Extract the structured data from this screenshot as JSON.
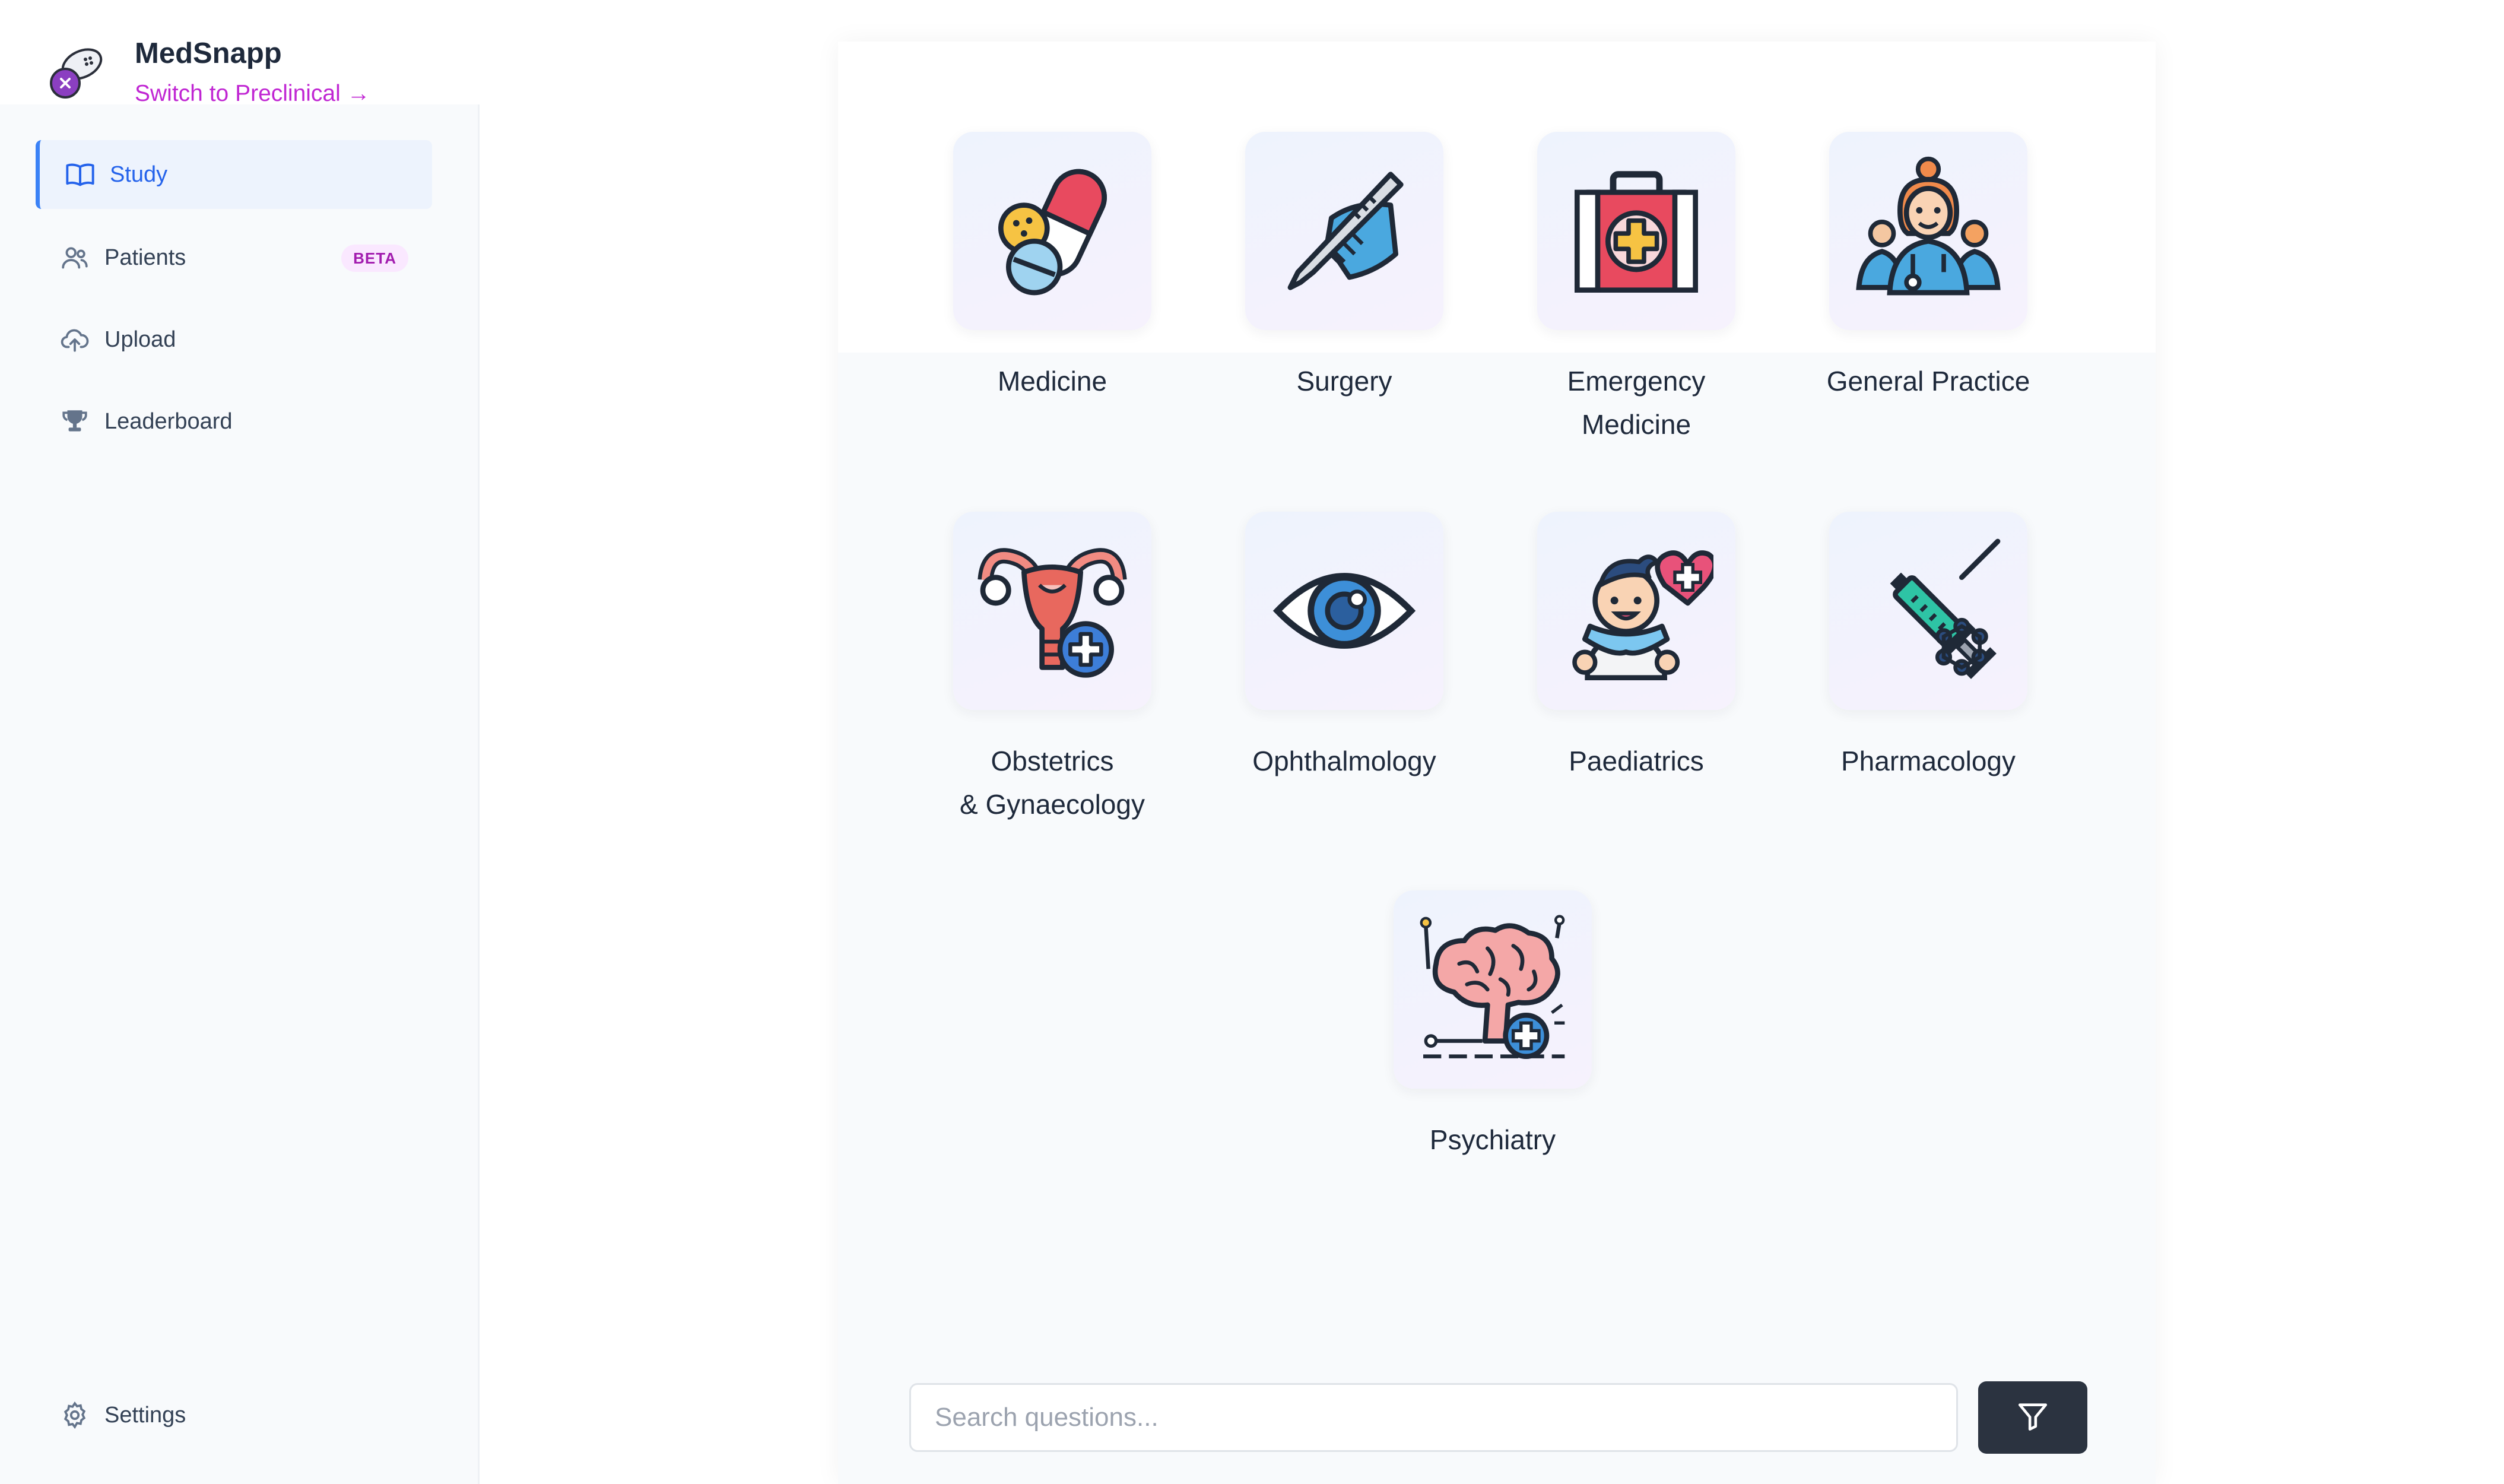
{
  "app": {
    "name": "MedSnapp",
    "switch_link": "Switch to Preclinical →"
  },
  "sidebar": {
    "items": [
      {
        "label": "Study",
        "icon": "book-icon",
        "active": true
      },
      {
        "label": "Patients",
        "icon": "users-icon",
        "badge": "BETA"
      },
      {
        "label": "Upload",
        "icon": "cloud-upload-icon"
      },
      {
        "label": "Leaderboard",
        "icon": "trophy-icon"
      }
    ],
    "settings": {
      "label": "Settings",
      "icon": "gear-icon"
    }
  },
  "specialties": [
    {
      "label": "Medicine",
      "icon": "pill-capsule-icon"
    },
    {
      "label": "Surgery",
      "icon": "scalpel-hand-icon"
    },
    {
      "label": "Emergency\nMedicine",
      "icon": "first-aid-kit-icon"
    },
    {
      "label": "General Practice",
      "icon": "doctor-team-icon"
    },
    {
      "label": "Obstetrics\n& Gynaecology",
      "icon": "uterus-icon"
    },
    {
      "label": "Ophthalmology",
      "icon": "eye-icon"
    },
    {
      "label": "Paediatrics",
      "icon": "baby-heart-icon"
    },
    {
      "label": "Pharmacology",
      "icon": "syringe-molecule-icon"
    },
    {
      "label": "Psychiatry",
      "icon": "brain-icon"
    }
  ],
  "search": {
    "placeholder": "Search questions...",
    "value": ""
  },
  "filter_button": {
    "icon": "filter-icon"
  },
  "colors": {
    "accent": "#3b82f6",
    "brand_link": "#c026d3",
    "beta_bg": "#fae8ff",
    "filter_button_bg": "#2b3340"
  }
}
